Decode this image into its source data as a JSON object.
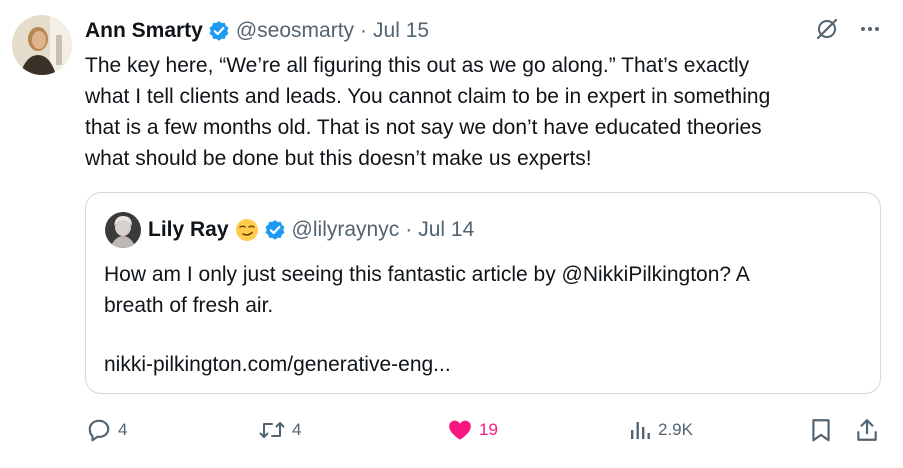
{
  "tweet": {
    "author_name": "Ann Smarty",
    "handle": "@seosmarty",
    "separator": "·",
    "date": "Jul 15",
    "text": "The key here, “We’re all figuring this out as we go along.” That’s exactly\nwhat I tell clients and leads. You cannot claim to be in expert in something\nthat is a few months old. That is not say we don’t have educated theories\nwhat should be done but this doesn’t make us experts!"
  },
  "quoted_tweet": {
    "author_name": "Lily Ray",
    "emoji": "smirking-face",
    "handle": "@lilyraynyc",
    "separator": "·",
    "date": "Jul 14",
    "text": "How am I only just seeing this fantastic article by @NikkiPilkington? A\nbreath of fresh air.",
    "link": "nikki-pilkington.com/generative-eng..."
  },
  "actions": {
    "replies": "4",
    "reposts": "4",
    "likes": "19",
    "views": "2.9K"
  },
  "colors": {
    "text": "#0f1419",
    "secondary": "#536471",
    "verified": "#1d9bf0",
    "like": "#f91880",
    "border": "#cfd9de"
  },
  "icons": [
    "grok-icon",
    "more-icon",
    "reply-icon",
    "repost-icon",
    "heart-icon",
    "views-icon",
    "bookmark-icon",
    "share-icon"
  ]
}
